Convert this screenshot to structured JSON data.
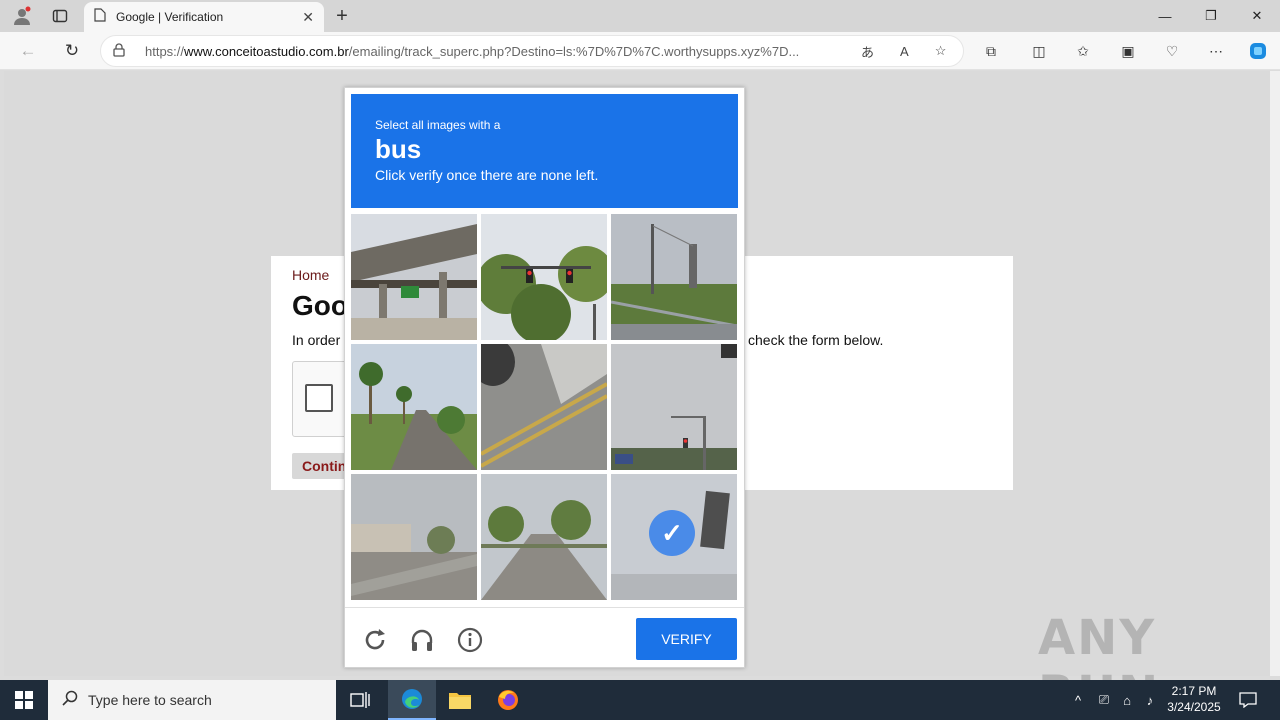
{
  "browser": {
    "tab_title": "Google | Verification",
    "url_prefix": "https://",
    "url_domain": "www.conceitoastudio.com.br",
    "url_rest": "/emailing/track_superc.php?Destino=ls:%7D%7D%7C.worthysupps.xyz%7D..."
  },
  "page": {
    "breadcrumb": "Home",
    "heading_partial": "Goo",
    "text_left": "In order",
    "text_right": "check the form below.",
    "continue_partial": "Contin"
  },
  "captcha": {
    "instruction_small": "Select all images with a",
    "target": "bus",
    "instruction_hint": "Click verify once there are none left.",
    "verify_label": "VERIFY",
    "selected_tiles": [
      8
    ],
    "accent_color": "#1a73e8"
  },
  "watermark": "ANY RUN",
  "taskbar": {
    "search_placeholder": "Type here to search",
    "time": "2:17 PM",
    "date": "3/24/2025"
  }
}
